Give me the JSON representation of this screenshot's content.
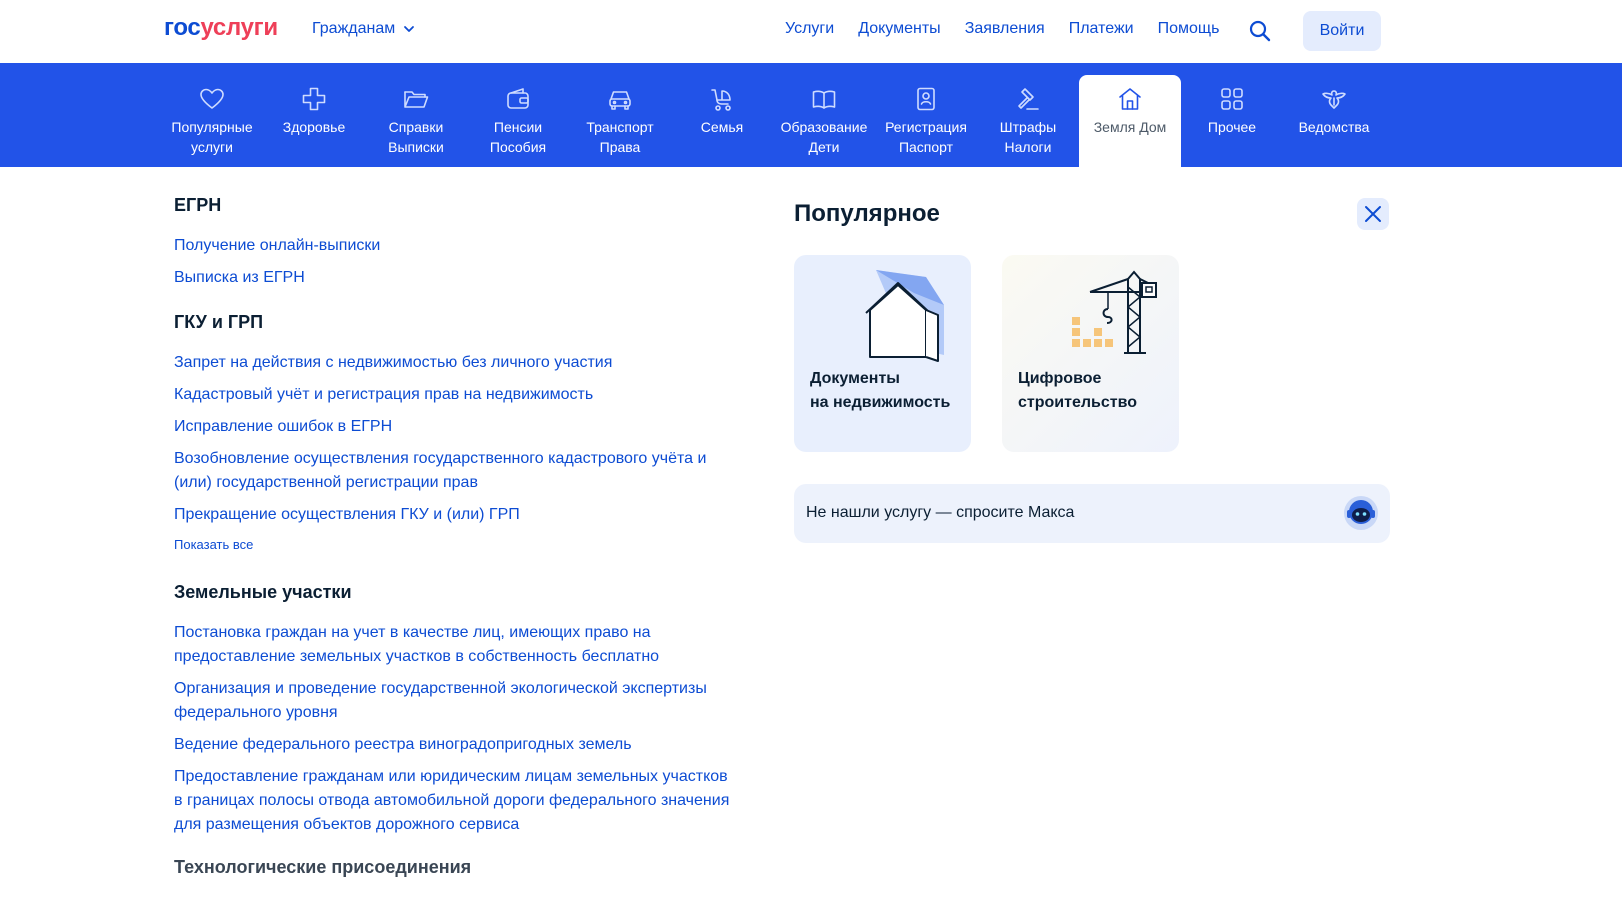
{
  "header": {
    "logo_part1": "гос",
    "logo_part2": "услуги",
    "audience": "Гражданам",
    "nav": [
      "Услуги",
      "Документы",
      "Заявления",
      "Платежи",
      "Помощь"
    ],
    "login": "Войти"
  },
  "colors": {
    "brand_blue": "#0d4cd3",
    "category_bar": "#2253e8",
    "logo_red": "#ee3f58",
    "light_blue_bg": "#e4ecfd"
  },
  "categories": [
    {
      "label": "Популярные\nуслуги",
      "icon": "heart-icon"
    },
    {
      "label": "Здоровье",
      "icon": "cross-icon"
    },
    {
      "label": "Справки\nВыписки",
      "icon": "folder-icon"
    },
    {
      "label": "Пенсии\nПособия",
      "icon": "wallet-icon"
    },
    {
      "label": "Транспорт\nПрава",
      "icon": "car-icon"
    },
    {
      "label": "Семья",
      "icon": "stroller-icon"
    },
    {
      "label": "Образование\nДети",
      "icon": "book-icon"
    },
    {
      "label": "Регистрация\nПаспорт",
      "icon": "passport-icon"
    },
    {
      "label": "Штрафы\nНалоги",
      "icon": "gavel-icon"
    },
    {
      "label": "Земля Дом",
      "icon": "house-icon",
      "active": true
    },
    {
      "label": "Прочее",
      "icon": "grid-icon"
    },
    {
      "label": "Ведомства",
      "icon": "emblem-icon"
    }
  ],
  "sections": {
    "egrn": {
      "title": "ЕГРН",
      "links": [
        "Получение онлайн-выписки",
        "Выписка из ЕГРН"
      ]
    },
    "gku": {
      "title": "ГКУ и ГРП",
      "links": [
        "Запрет на действия с недвижимостью без личного участия",
        "Кадастровый учёт и регистрация прав на недвижимость",
        "Исправление ошибок в ЕГРН",
        "Возобновление осуществления государственного кадастрового учёта и (или) государственной регистрации прав",
        "Прекращение осуществления ГКУ и (или) ГРП"
      ],
      "show_all": "Показать все"
    },
    "land": {
      "title": "Земельные участки",
      "links": [
        "Постановка граждан на учет в качестве лиц, имеющих право на предоставление земельных участков в собственность бесплатно",
        "Организация и проведение государственной экологической экспертизы федерального уровня",
        "Ведение федерального реестра виноградопригодных земель",
        "Предоставление гражданам или юридическим лицам земельных участков в границах полосы отвода автомобильной дороги федерального значения для размещения объектов дорожного сервиса"
      ]
    },
    "tech": {
      "title": "Технологические присоединения"
    }
  },
  "popular": {
    "title": "Популярное",
    "cards": [
      {
        "line1": "Документы",
        "line2": "на недвижимость",
        "icon": "house-document-icon"
      },
      {
        "line1": "Цифровое",
        "line2": "строительство",
        "icon": "crane-icon"
      }
    ],
    "ask": "Не нашли услугу — спросите Макса"
  }
}
